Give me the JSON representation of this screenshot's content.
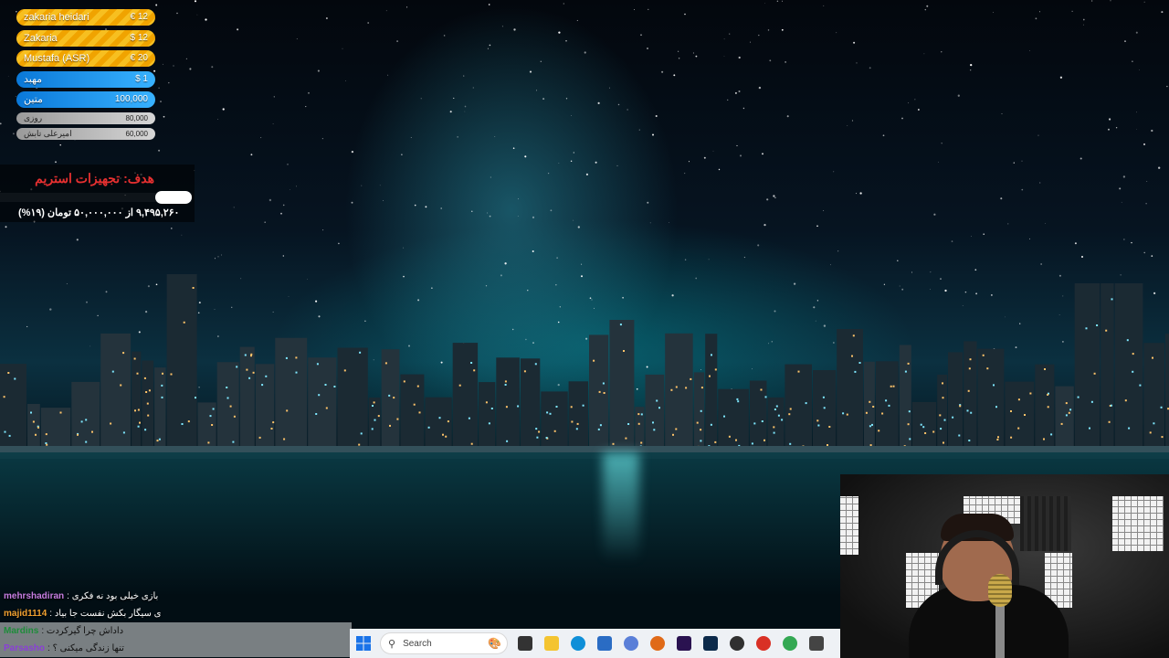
{
  "donations": [
    {
      "name": "zakaria heidari",
      "amount": "€ 12",
      "style": "gold"
    },
    {
      "name": "Zakaria",
      "amount": "$ 12",
      "style": "gold"
    },
    {
      "name": "Mustafa (ASR)",
      "amount": "€ 20",
      "style": "gold"
    },
    {
      "name": "مهبد",
      "amount": "$ 1",
      "style": "blue"
    },
    {
      "name": "متین",
      "amount": "100,000",
      "style": "blue"
    },
    {
      "name": "روزی",
      "amount": "80,000",
      "style": "grey"
    },
    {
      "name": "امیرعلی تابش",
      "amount": "60,000",
      "style": "grey"
    }
  ],
  "goal": {
    "title": "هدف: تجهیزات استریم",
    "progress_text": "۹,۴۹۵,۲۶۰ از ۵۰,۰۰۰,۰۰۰ تومان (۱۹%)",
    "progress_fraction": 0.19
  },
  "chat": [
    {
      "user": "mehrshadiran",
      "message": ": بازی خیلی بود نه فکری",
      "user_color": "#c77de0"
    },
    {
      "user": "majid1114",
      "message": ": ی سیگار بکش نفست جا بیاد",
      "user_color": "#f0a030"
    },
    {
      "user": "Mardins",
      "message": ": داداش چرا گیرکردت",
      "user_color": "#1e8c3a"
    },
    {
      "user": "Parsasho",
      "message": ": تنها زندگی میکنی ؟",
      "user_color": "#8a3fd6"
    }
  ],
  "taskbar": {
    "search_placeholder": "Search",
    "apps": [
      {
        "name": "start-icon",
        "color": "#1a73e8"
      },
      {
        "name": "task-view-icon",
        "color": "#333333"
      },
      {
        "name": "file-explorer-icon",
        "color": "#f4c430"
      },
      {
        "name": "edge-icon",
        "color": "#0f8fd8"
      },
      {
        "name": "store-icon",
        "color": "#2a6cc4"
      },
      {
        "name": "internet-icon",
        "color": "#5a7fd8"
      },
      {
        "name": "firefox-icon",
        "color": "#e06a18"
      },
      {
        "name": "premiere-icon",
        "color": "#2a1250"
      },
      {
        "name": "photoshop-icon",
        "color": "#0c2a4a"
      },
      {
        "name": "obs-icon",
        "color": "#303030"
      },
      {
        "name": "chrome-icon",
        "color": "#d93025"
      },
      {
        "name": "chrome-profile-icon",
        "color": "#34a853"
      },
      {
        "name": "app-icon",
        "color": "#444444"
      }
    ]
  }
}
